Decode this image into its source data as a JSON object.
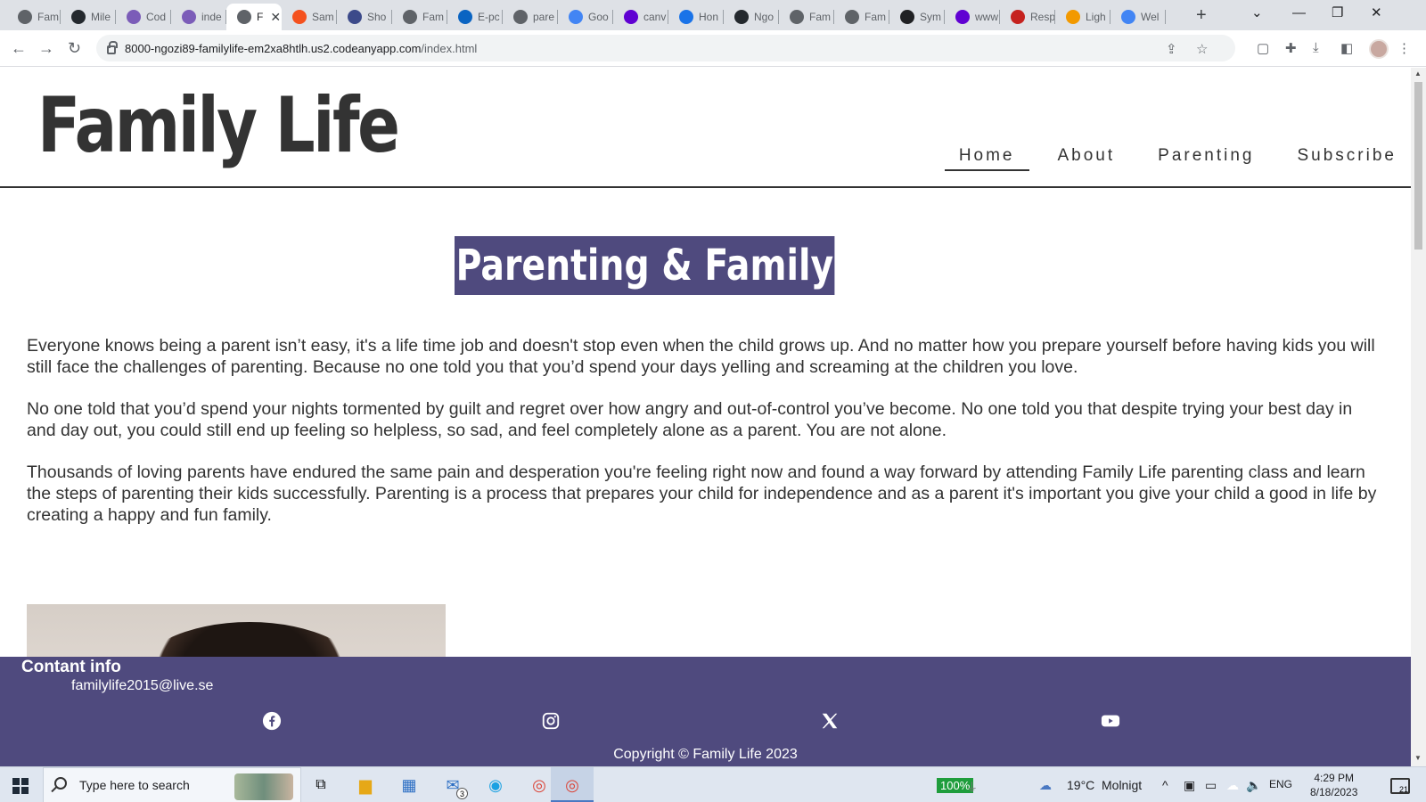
{
  "browser": {
    "tabs": [
      {
        "label": "Fam",
        "icon": "globe-icon",
        "color": "#5f6368"
      },
      {
        "label": "Mile",
        "icon": "github-icon",
        "color": "#24292e"
      },
      {
        "label": "Cod",
        "icon": "cube-icon",
        "color": "#7b5cb8"
      },
      {
        "label": "inde",
        "icon": "cube-icon",
        "color": "#7b5cb8"
      },
      {
        "label": "F",
        "icon": "globe-icon",
        "color": "#5f6368",
        "active": true
      },
      {
        "label": "Sam",
        "icon": "ring-icon",
        "color": "#f4511e"
      },
      {
        "label": "Sho",
        "icon": "shop-icon",
        "color": "#3c4a8a"
      },
      {
        "label": "Fam",
        "icon": "globe-icon",
        "color": "#5f6368"
      },
      {
        "label": "E-pc",
        "icon": "outlook-icon",
        "color": "#0a64c2"
      },
      {
        "label": "pare",
        "icon": "globe-icon",
        "color": "#5f6368"
      },
      {
        "label": "Goo",
        "icon": "translate-icon",
        "color": "#4285f4"
      },
      {
        "label": "canv",
        "icon": "yahoo-icon",
        "color": "#6001d2"
      },
      {
        "label": "Hon",
        "icon": "c-icon",
        "color": "#1a73e8"
      },
      {
        "label": "Ngo",
        "icon": "github-icon",
        "color": "#24292e"
      },
      {
        "label": "Fam",
        "icon": "globe-icon",
        "color": "#5f6368"
      },
      {
        "label": "Fam",
        "icon": "globe-icon",
        "color": "#5f6368"
      },
      {
        "label": "Sym",
        "icon": "smiley-icon",
        "color": "#202124"
      },
      {
        "label": "www",
        "icon": "yahoo-icon",
        "color": "#6001d2"
      },
      {
        "label": "Resp",
        "icon": "triangle-icon",
        "color": "#c5221f"
      },
      {
        "label": "Ligh",
        "icon": "lighthouse-icon",
        "color": "#f29900"
      },
      {
        "label": "Wel",
        "icon": "google-icon",
        "color": "#4285f4"
      }
    ],
    "url_host": "8000-ngozi89-familylife-em2xa8htlh.us2.codeanyapp.com",
    "url_path": "/index.html"
  },
  "site": {
    "logo": "Family Life",
    "nav": [
      "Home",
      "About",
      "Parenting",
      "Subscribe"
    ],
    "active_nav": "Home"
  },
  "main": {
    "title": "Parenting & Family",
    "paragraphs": [
      "Everyone knows being a parent isn’t easy, it's a life time job and doesn't stop even when the child grows up. And no matter how you prepare yourself before having kids you will still face the challenges of parenting. Because no one told you that you’d spend your days yelling and screaming at the children you love.",
      "No one told that you’d spend your nights tormented by guilt and regret over how angry and out-of-control you’ve become. No one told you that despite trying your best day in and day out, you could still end up feeling so helpless, so sad, and feel completely alone as a parent. You are not alone.",
      "Thousands of loving parents have endured the same pain and desperation you're feeling right now and found a way forward by attending Family Life parenting class and learn the steps of parenting their kids successfully. Parenting is a process that prepares your child for independence and as a parent it's important you give your child a good in life by creating a happy and fun family."
    ]
  },
  "footer": {
    "heading": "Contant info",
    "email": "familylife2015@live.se",
    "social": [
      "facebook-icon",
      "instagram-icon",
      "x-icon",
      "youtube-icon"
    ],
    "copyright": "Copyright © Family Life 2023"
  },
  "taskbar": {
    "search_placeholder": "Type here to search",
    "mail_badge": "3",
    "battery": "100%",
    "weather_temp": "19°C",
    "weather_text": "Molnigt",
    "language": "ENG",
    "time": "4:29 PM",
    "date": "8/18/2023",
    "notifications": "21"
  },
  "colors": {
    "accent": "#4f4a7e",
    "text": "#333333"
  }
}
